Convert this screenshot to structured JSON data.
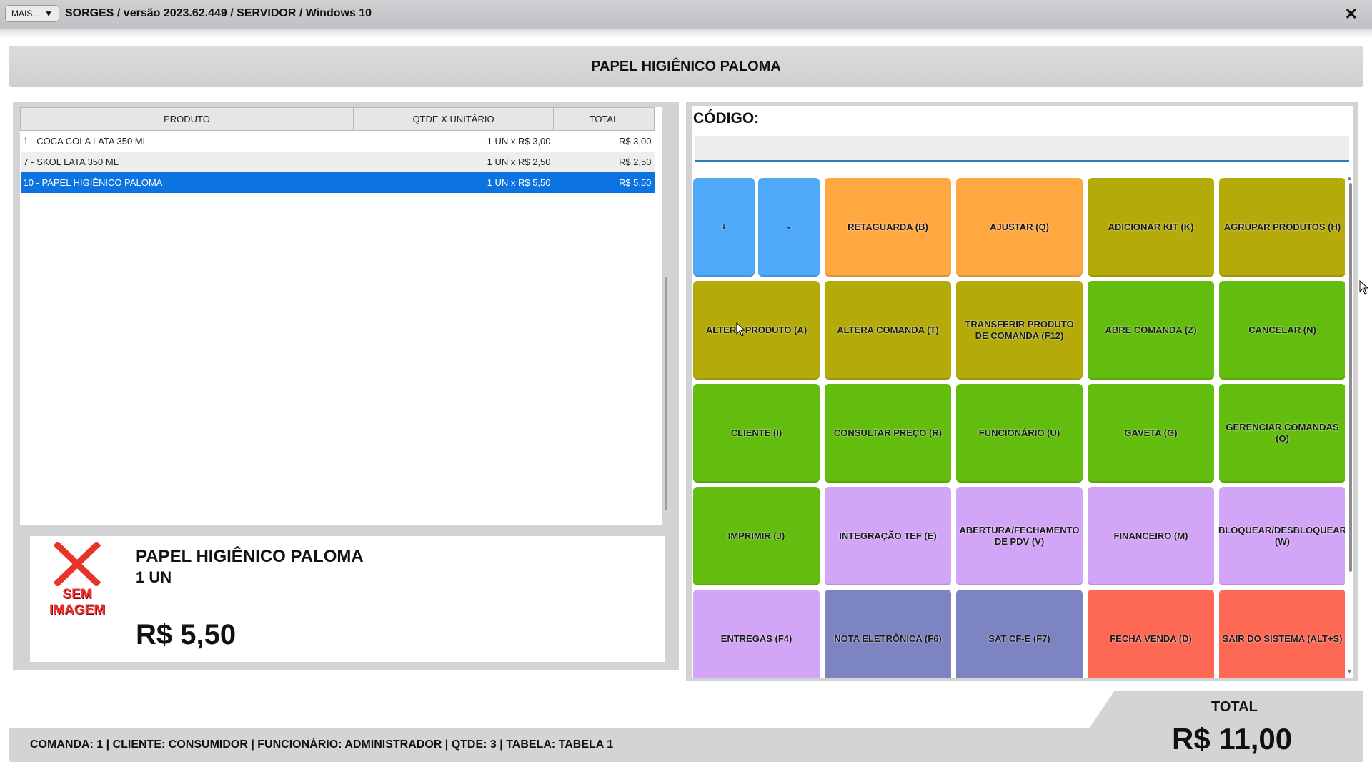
{
  "titlebar": {
    "mais_label": "MAIS...",
    "title": "SORGES / versão 2023.62.449 / SERVIDOR / Windows 10",
    "close_label": "✕"
  },
  "header": {
    "product_name": "PAPEL HIGIÊNICO PALOMA"
  },
  "table": {
    "headers": [
      "PRODUTO",
      "QTDE X UNITÁRIO",
      "TOTAL"
    ],
    "rows": [
      {
        "produto": "1 - COCA COLA LATA 350 ML",
        "qtde": "1 UN x R$ 3,00",
        "total": "R$ 3,00"
      },
      {
        "produto": "7 - SKOL LATA 350 ML",
        "qtde": "1 UN x R$ 2,50",
        "total": "R$ 2,50"
      },
      {
        "produto": "10 - PAPEL HIGIÊNICO PALOMA",
        "qtde": "1 UN x R$ 5,50",
        "total": "R$ 5,50"
      }
    ],
    "selected_index": 2
  },
  "detail": {
    "no_image_line1": "SEM",
    "no_image_line2": "IMAGEM",
    "name": "PAPEL HIGIÊNICO PALOMA",
    "qty": "1  UN",
    "price": "R$ 5,50"
  },
  "codigo": {
    "label": "CÓDIGO:",
    "value": ""
  },
  "colors": {
    "blue": "#4ea9f8",
    "orange": "#ffa840",
    "olive": "#b4ab0a",
    "green": "#62bd0e",
    "lavender": "#d2a5f6",
    "slate": "#7d84c2",
    "red": "#fe6956",
    "selection": "#0b74e0"
  },
  "buttons": [
    {
      "label": "+",
      "color": "blue"
    },
    {
      "label": "-",
      "color": "blue"
    },
    {
      "label": "RETAGUARDA (B)",
      "color": "orange"
    },
    {
      "label": "AJUSTAR (Q)",
      "color": "orange"
    },
    {
      "label": "ADICIONAR KIT (K)",
      "color": "olive"
    },
    {
      "label": "AGRUPAR PRODUTOS (H)",
      "color": "olive"
    },
    {
      "label": "ALTERA PRODUTO (A)",
      "color": "olive"
    },
    {
      "label": "ALTERA COMANDA (T)",
      "color": "olive"
    },
    {
      "label": "TRANSFERIR PRODUTO DE COMANDA (F12)",
      "color": "olive"
    },
    {
      "label": "ABRE COMANDA (Z)",
      "color": "green"
    },
    {
      "label": "CANCELAR (N)",
      "color": "green"
    },
    {
      "label": "CLIENTE (I)",
      "color": "green"
    },
    {
      "label": "CONSULTAR PREÇO (R)",
      "color": "green"
    },
    {
      "label": "FUNCIONÁRIO (U)",
      "color": "green"
    },
    {
      "label": "GAVETA (G)",
      "color": "green"
    },
    {
      "label": "GERENCIAR COMANDAS (O)",
      "color": "green"
    },
    {
      "label": "IMPRIMIR (J)",
      "color": "green"
    },
    {
      "label": "INTEGRAÇÃO TEF (E)",
      "color": "lavender"
    },
    {
      "label": "ABERTURA/FECHAMENTO DE PDV (V)",
      "color": "lavender"
    },
    {
      "label": "FINANCEIRO (M)",
      "color": "lavender"
    },
    {
      "label": "BLOQUEAR/DESBLOQUEAR (W)",
      "color": "lavender"
    },
    {
      "label": "ENTREGAS (F4)",
      "color": "lavender"
    },
    {
      "label": "NOTA ELETRÔNICA (F6)",
      "color": "slate"
    },
    {
      "label": "SAT CF-E (F7)",
      "color": "slate"
    },
    {
      "label": "FECHA VENDA (D)",
      "color": "red"
    },
    {
      "label": "SAIR DO SISTEMA (ALT+S)",
      "color": "red"
    }
  ],
  "footer": {
    "status": "COMANDA: 1  |  CLIENTE: CONSUMIDOR  |  FUNCIONÁRIO: ADMINISTRADOR  |  QTDE: 3  |  TABELA: TABELA 1",
    "total_label": "TOTAL",
    "total_value": "R$ 11,00"
  }
}
